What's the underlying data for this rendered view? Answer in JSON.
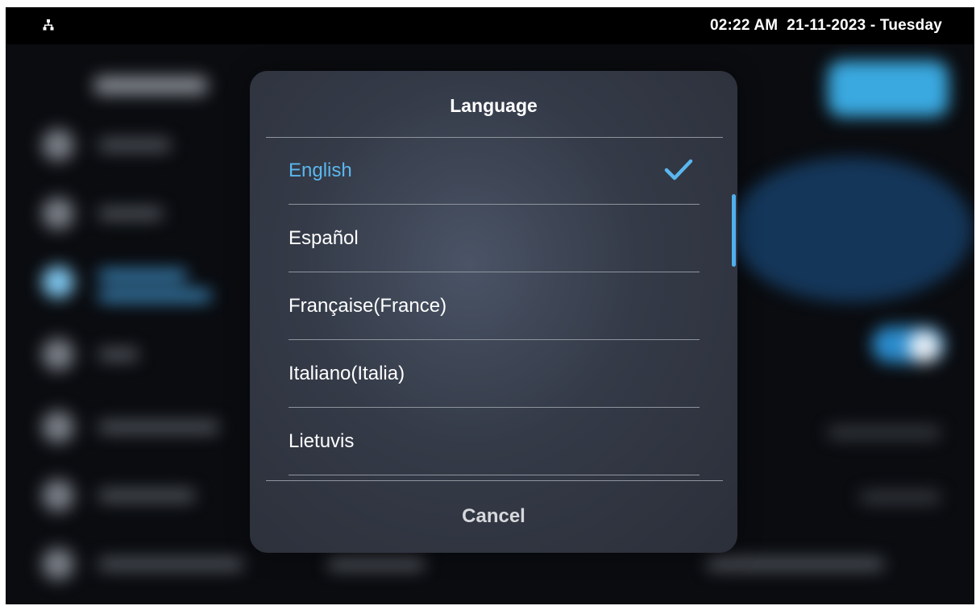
{
  "status_bar": {
    "time": "02:22 AM",
    "date": "21-11-2023 - Tuesday",
    "network_icon": "network-tree-icon"
  },
  "dialog": {
    "title": "Language",
    "languages": [
      {
        "label": "English",
        "selected": true
      },
      {
        "label": "Español",
        "selected": false
      },
      {
        "label": "Française(France)",
        "selected": false
      },
      {
        "label": "Italiano(Italia)",
        "selected": false
      },
      {
        "label": "Lietuvis",
        "selected": false
      }
    ],
    "cancel_label": "Cancel"
  },
  "colors": {
    "accent": "#5ab7ee",
    "status_bar_bg": "#000000",
    "dialog_bg": "#343a47"
  }
}
